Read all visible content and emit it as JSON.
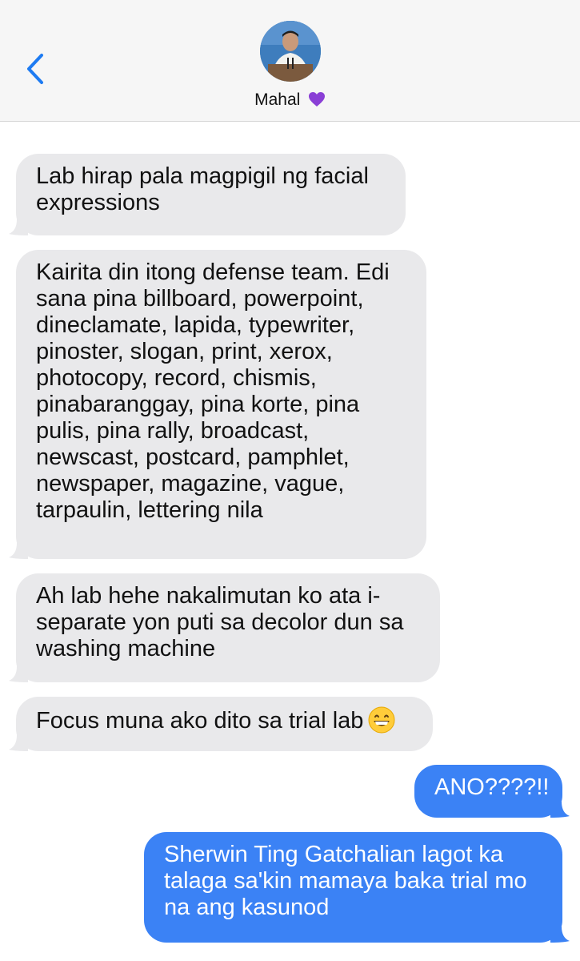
{
  "header": {
    "back_icon": "chevron-left-icon",
    "contact_name": "Mahal",
    "name_emoji": "💜",
    "accent_color": "#1d7bf2"
  },
  "messages": [
    {
      "side": "received",
      "text": "Lab hirap pala magpigil ng facial expressions"
    },
    {
      "side": "received",
      "text": "Kairita din itong defense team. Edi sana pina billboard, powerpoint, dineclamate, lapida, typewriter, pinoster, slogan, print, xerox, photocopy, record, chismis, pinabaranggay, pina korte, pina pulis, pina rally, broadcast, newscast, postcard, pamphlet, newspaper, magazine, vague, tarpaulin, lettering nila"
    },
    {
      "side": "received",
      "text": "Ah lab hehe nakalimutan ko ata i-separate yon puti sa decolor dun sa washing machine"
    },
    {
      "side": "received",
      "text": "Focus muna ako dito sa trial lab",
      "emoji": "grinning-face-icon"
    },
    {
      "side": "sent",
      "text": "ANO????!!"
    },
    {
      "side": "sent",
      "text": "Sherwin Ting Gatchalian lagot ka talaga sa'kin mamaya baka trial mo na ang kasunod"
    }
  ]
}
